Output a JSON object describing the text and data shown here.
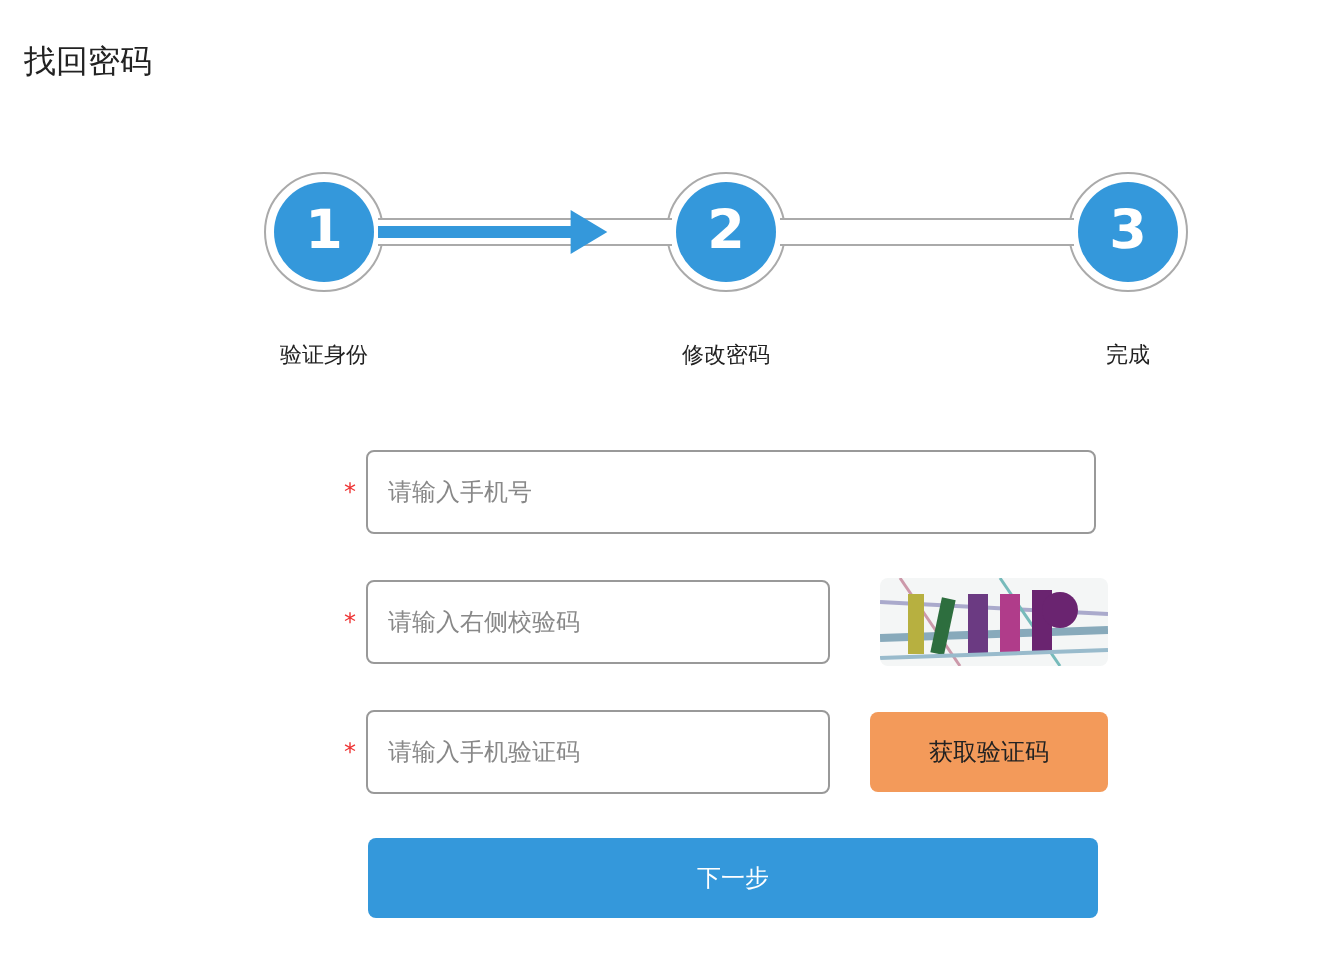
{
  "title": "找回密码",
  "steps": [
    {
      "number": "1",
      "label": "验证身份"
    },
    {
      "number": "2",
      "label": "修改密码"
    },
    {
      "number": "3",
      "label": "完成"
    }
  ],
  "connectors": [
    {
      "arrow": true
    },
    {
      "arrow": false
    }
  ],
  "form": {
    "fields": [
      {
        "kind": "text",
        "required_mark": "*",
        "placeholder": "请输入手机号"
      },
      {
        "kind": "captcha",
        "required_mark": "*",
        "placeholder": "请输入右侧校验码"
      },
      {
        "kind": "sms",
        "required_mark": "*",
        "placeholder": "请输入手机验证码",
        "button": "获取验证码"
      }
    ],
    "submit": "下一步"
  }
}
